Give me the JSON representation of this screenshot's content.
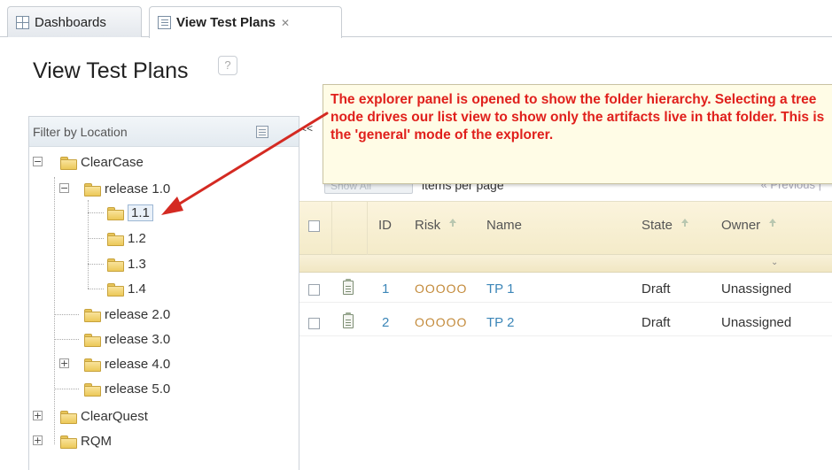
{
  "tabs": [
    {
      "label": "Dashboards",
      "active": false
    },
    {
      "label": "View Test Plans",
      "active": true
    }
  ],
  "page": {
    "title": "View Test Plans",
    "help_label": "?"
  },
  "left_panel": {
    "header": "Filter by Location",
    "collapse_label": "<<",
    "tree": {
      "clearcase": "ClearCase",
      "release_1_0": "release 1.0",
      "n_1_1": "1.1",
      "n_1_2": "1.2",
      "n_1_3": "1.3",
      "n_1_4": "1.4",
      "release_2_0": "release 2.0",
      "release_3_0": "release 3.0",
      "release_4_0": "release 4.0",
      "release_5_0": "release 5.0",
      "clearquest": "ClearQuest",
      "rqm": "RQM"
    },
    "selected": "1.1"
  },
  "toolbar": {
    "show_all": "Show All",
    "items_per_page": "items per page",
    "previous": "« Previous |"
  },
  "grid": {
    "columns": {
      "id": "ID",
      "risk": "Risk",
      "name": "Name",
      "state": "State",
      "owner": "Owner"
    },
    "rows": [
      {
        "id": "1",
        "risk": "OOOOO",
        "name": "TP 1",
        "state": "Draft",
        "owner": "Unassigned"
      },
      {
        "id": "2",
        "risk": "OOOOO",
        "name": "TP 2",
        "state": "Draft",
        "owner": "Unassigned"
      }
    ]
  },
  "callout": {
    "text": "The explorer panel is opened to show the folder hierarchy. Selecting a tree node drives our list view to show only the artifacts live in that folder. This is the 'general' mode of the explorer."
  },
  "colors": {
    "callout_text": "#e0201c",
    "arrow": "#d42a22",
    "link": "#3c86b8",
    "header_bg": "#f7efd2"
  }
}
